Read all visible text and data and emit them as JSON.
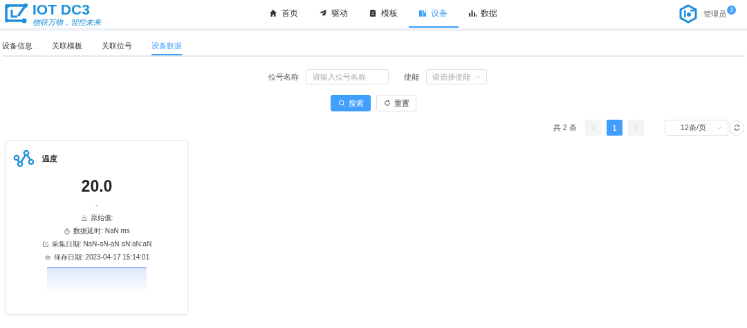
{
  "logo": {
    "title": "IOT DC3",
    "slogan": "物联万物，智控未来"
  },
  "nav": [
    {
      "label": "首页",
      "selected": false
    },
    {
      "label": "驱动",
      "selected": false
    },
    {
      "label": "模板",
      "selected": false
    },
    {
      "label": "设备",
      "selected": true
    },
    {
      "label": "数据",
      "selected": false
    }
  ],
  "user": {
    "name": "管理员",
    "badge": "3"
  },
  "tabs": [
    {
      "label": "设备信息",
      "selected": false
    },
    {
      "label": "关联模板",
      "selected": false
    },
    {
      "label": "关联位号",
      "selected": false
    },
    {
      "label": "设备数据",
      "selected": true
    }
  ],
  "filters": [
    {
      "label": "位号名称",
      "kind": "input",
      "placeholder": "请输入位号名称"
    },
    {
      "label": "使能",
      "kind": "select",
      "placeholder": "请选择使能"
    }
  ],
  "buttons": [
    {
      "label": "搜索",
      "kind": "primary"
    },
    {
      "label": "重置",
      "kind": "default"
    }
  ],
  "pagination": {
    "total": "共 2 条",
    "pages": [
      {
        "label": "1",
        "selected": true
      }
    ],
    "page_size": "12条/页"
  },
  "cards": [
    {
      "name": "温度",
      "value": "20.0",
      "unit": "-",
      "lines": [
        {
          "text": "原始值:"
        },
        {
          "text": "数据延时: NaN ms"
        },
        {
          "text": "采集日期: NaN-aN-aN aN:aN:aN"
        },
        {
          "text": "保存日期: 2023-04-17 15:14:01"
        }
      ]
    }
  ]
}
